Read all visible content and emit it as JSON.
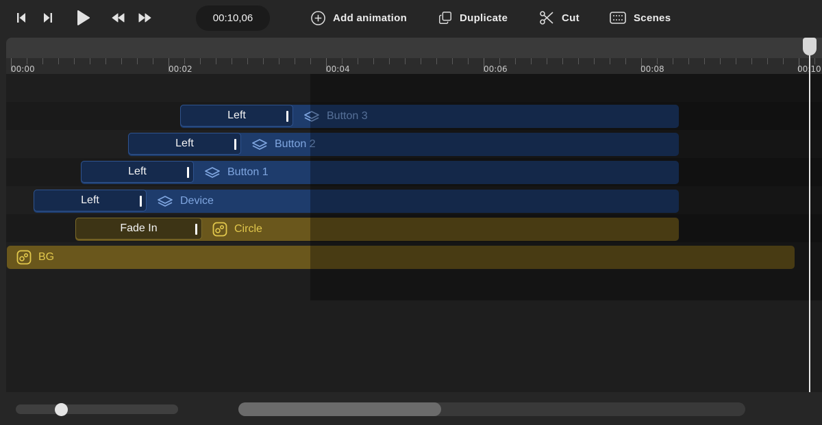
{
  "toolbar": {
    "timecode": "00:10,06",
    "actions": [
      {
        "label": "Add animation",
        "icon": "plus-circle-icon"
      },
      {
        "label": "Duplicate",
        "icon": "duplicate-icon"
      },
      {
        "label": "Cut",
        "icon": "scissors-icon"
      },
      {
        "label": "Scenes",
        "icon": "scenes-icon"
      }
    ],
    "transport_icons": [
      "skip-to-start-icon",
      "skip-to-end-icon",
      "play-icon",
      "rewind-icon",
      "fast-forward-icon"
    ]
  },
  "ruler": {
    "labels": [
      "00:00",
      "00:02",
      "00:04",
      "00:06",
      "00:08",
      "00:10"
    ],
    "playhead_time": "00:10,06"
  },
  "tracks": [
    {
      "name": "Button 3",
      "type": "layer",
      "icon": "layers-icon",
      "animation": "Left",
      "color": "blue"
    },
    {
      "name": "Button 2",
      "type": "layer",
      "icon": "layers-icon",
      "animation": "Left",
      "color": "blue"
    },
    {
      "name": "Button 1",
      "type": "layer",
      "icon": "layers-icon",
      "animation": "Left",
      "color": "blue"
    },
    {
      "name": "Device",
      "type": "layer",
      "icon": "layers-icon",
      "animation": "Left",
      "color": "blue"
    },
    {
      "name": "Circle",
      "type": "shape",
      "icon": "shape-icon",
      "animation": "Fade In",
      "color": "yellow"
    },
    {
      "name": "BG",
      "type": "shape",
      "icon": "shape-icon",
      "animation": "",
      "color": "yellow"
    }
  ],
  "colors": {
    "blue_clip": "#1e3c6c",
    "blue_label": "#7fa6e0",
    "yellow_clip": "#6a571c",
    "yellow_label": "#e2c84c"
  },
  "zoom_level": 0.28,
  "scroll_position": 0.0
}
